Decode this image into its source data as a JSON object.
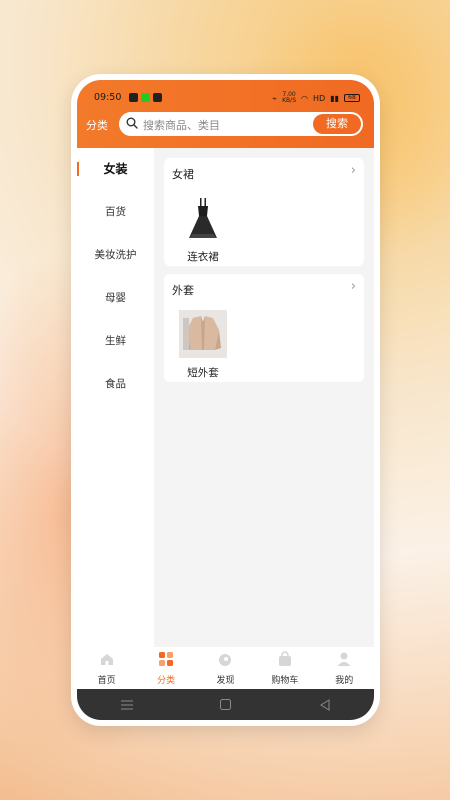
{
  "status": {
    "time": "09:50",
    "speed": "7.00",
    "speed_unit": "KB/S",
    "hd": "HD",
    "battery": "68"
  },
  "header": {
    "category_label": "分类",
    "search_placeholder": "搜索商品、类目",
    "search_button": "搜索"
  },
  "sidebar": {
    "items": [
      {
        "label": "女装",
        "active": true
      },
      {
        "label": "百货"
      },
      {
        "label": "美妆洗护"
      },
      {
        "label": "母婴"
      },
      {
        "label": "生鲜"
      },
      {
        "label": "食品"
      }
    ]
  },
  "sections": [
    {
      "title": "女裙",
      "products": [
        {
          "name": "连衣裙",
          "icon": "dress-image"
        }
      ]
    },
    {
      "title": "外套",
      "products": [
        {
          "name": "短外套",
          "icon": "jacket-image"
        }
      ]
    }
  ],
  "tabbar": {
    "items": [
      {
        "label": "首页",
        "icon": "home-icon"
      },
      {
        "label": "分类",
        "icon": "category-icon",
        "active": true
      },
      {
        "label": "发现",
        "icon": "discover-icon"
      },
      {
        "label": "购物车",
        "icon": "cart-icon"
      },
      {
        "label": "我的",
        "icon": "profile-icon"
      }
    ]
  },
  "colors": {
    "accent": "#f06a23",
    "navbar": "#333333"
  }
}
